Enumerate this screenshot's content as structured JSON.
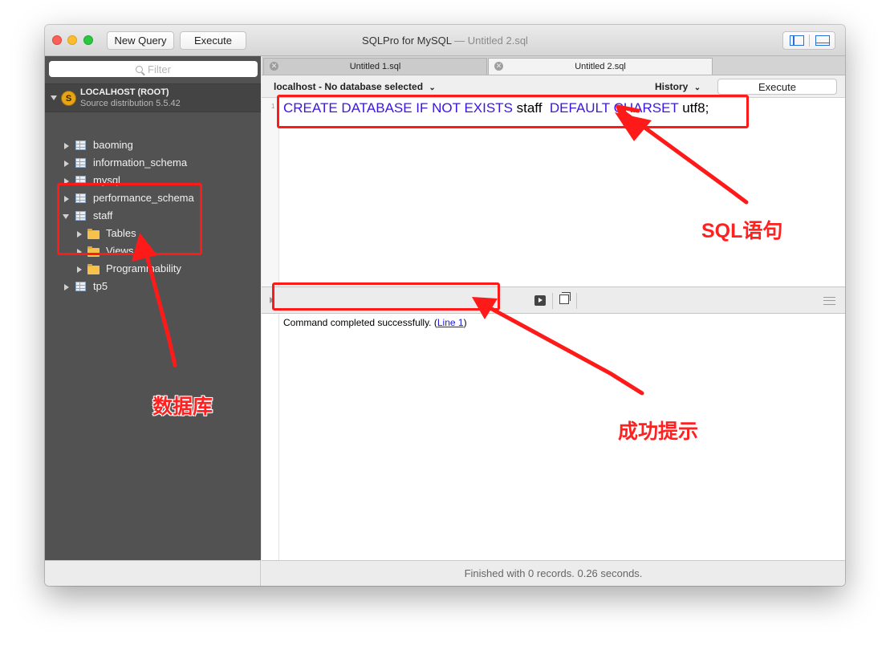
{
  "window": {
    "app_title": "SQLPro for MySQL",
    "doc_title": "— Untitled 2.sql",
    "toolbar": {
      "new_query": "New Query",
      "execute": "Execute"
    }
  },
  "sidebar": {
    "filter_placeholder": "Filter",
    "server": {
      "name": "LOCALHOST (ROOT)",
      "subtitle": "Source distribution 5.5.42",
      "logo_glyph": "S"
    },
    "databases": [
      {
        "name": "baoming"
      },
      {
        "name": "information_schema"
      },
      {
        "name": "mysql"
      },
      {
        "name": "performance_schema"
      },
      {
        "name": "staff",
        "expanded": true,
        "children": [
          "Tables",
          "Views",
          "Programmability"
        ]
      },
      {
        "name": "tp5"
      }
    ]
  },
  "editor": {
    "tabs": [
      {
        "label": "Untitled 1.sql",
        "active": false
      },
      {
        "label": "Untitled 2.sql",
        "active": true
      }
    ],
    "database_selector": "localhost - No database selected",
    "history_label": "History",
    "execute_label": "Execute",
    "line_number": "1",
    "sql": {
      "part1": "CREATE DATABASE IF NOT EXISTS",
      "part2": " staff  ",
      "part3": "DEFAULT CHARSET",
      "part4": " utf8;"
    }
  },
  "results": {
    "message_prefix": "Command completed successfully. (",
    "message_link": "Line 1",
    "message_suffix": ")",
    "status": "Finished with 0 records. 0.26 seconds."
  },
  "annotations": {
    "sql_label": "SQL语句",
    "db_label": "数据库",
    "success_label": "成功提示",
    "color": "#ff1a1a"
  }
}
